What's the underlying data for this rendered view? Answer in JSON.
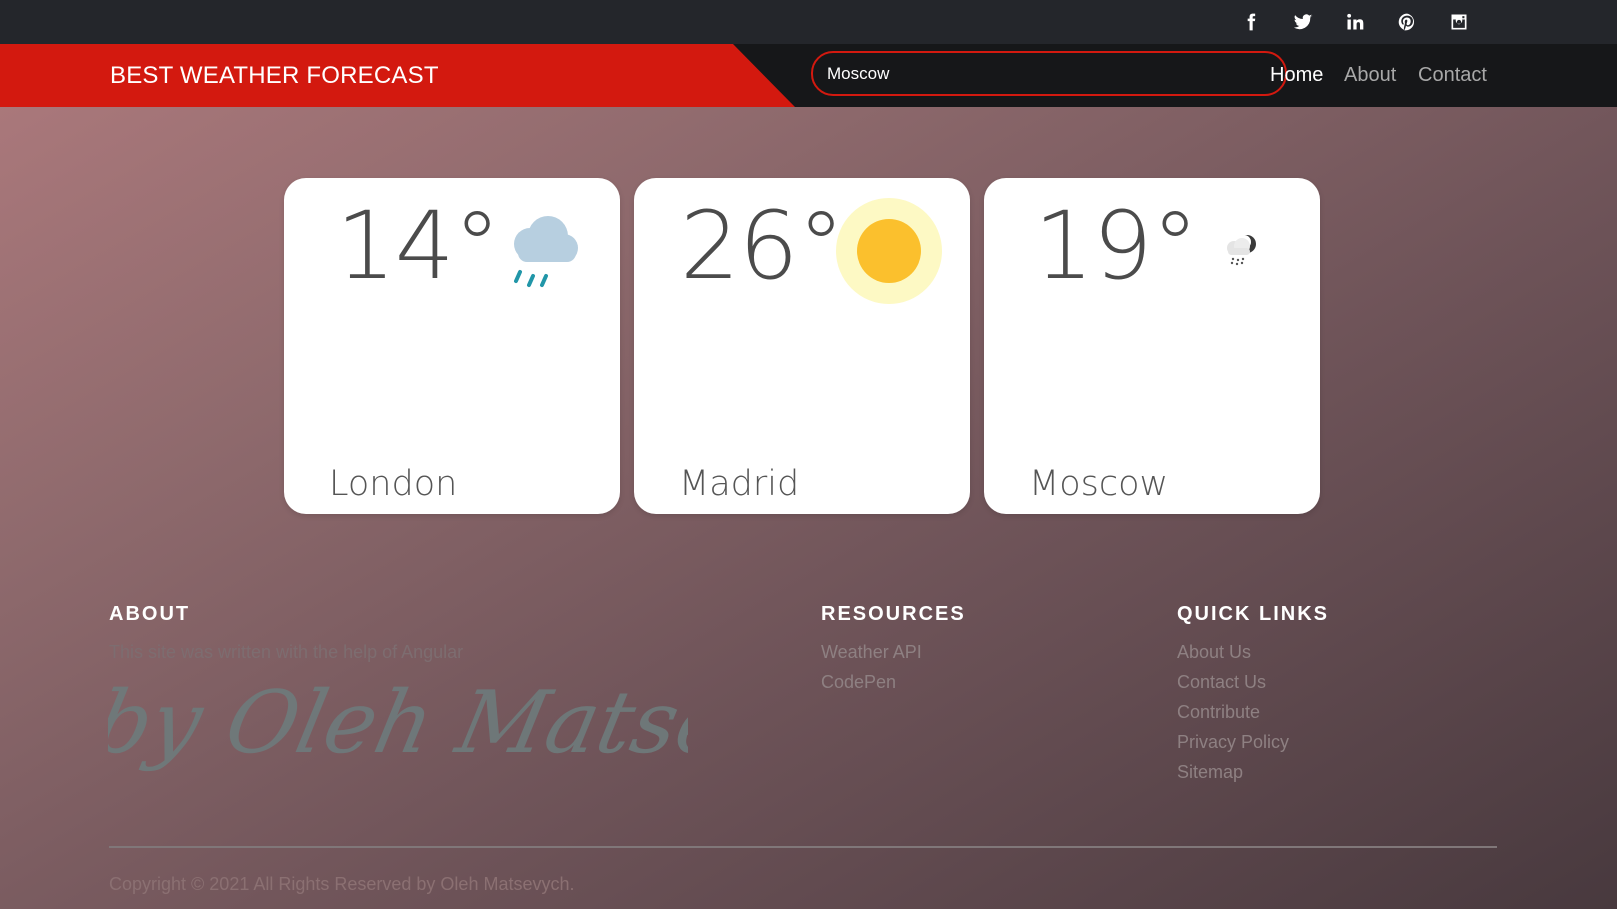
{
  "brand": "BEST WEATHER FORECAST",
  "search": {
    "value": "Moscow",
    "placeholder": ""
  },
  "nav": {
    "home": "Home",
    "about": "About",
    "contact": "Contact"
  },
  "social_icons": [
    "facebook-icon",
    "twitter-icon",
    "linkedin-icon",
    "pinterest-icon",
    "instagram-icon"
  ],
  "cards": [
    {
      "temp": "14°",
      "city": "London",
      "icon": "rain-cloud-icon"
    },
    {
      "temp": "26°",
      "city": "Madrid",
      "icon": "sun-icon"
    },
    {
      "temp": "19°",
      "city": "Moscow",
      "icon": "night-drizzle-icon"
    }
  ],
  "footer": {
    "about": {
      "heading": "ABOUT",
      "text": "This site was written with the help of Angular",
      "signature": "by Oleh Matsevych"
    },
    "resources": {
      "heading": "RESOURCES",
      "links": [
        "Weather API",
        "CodePen"
      ]
    },
    "quick_links": {
      "heading": "QUICK LINKS",
      "links": [
        "About Us",
        "Contact Us",
        "Contribute",
        "Privacy Policy",
        "Sitemap"
      ]
    },
    "copyright": "Copyright © 2021 All Rights Reserved by Oleh Matsevych."
  },
  "colors": {
    "accent": "#d3190f",
    "topbar": "#24262b",
    "navbar": "#161719",
    "card": "#ffffff",
    "sun": "#fbc02d",
    "rain": "#2196a8"
  }
}
